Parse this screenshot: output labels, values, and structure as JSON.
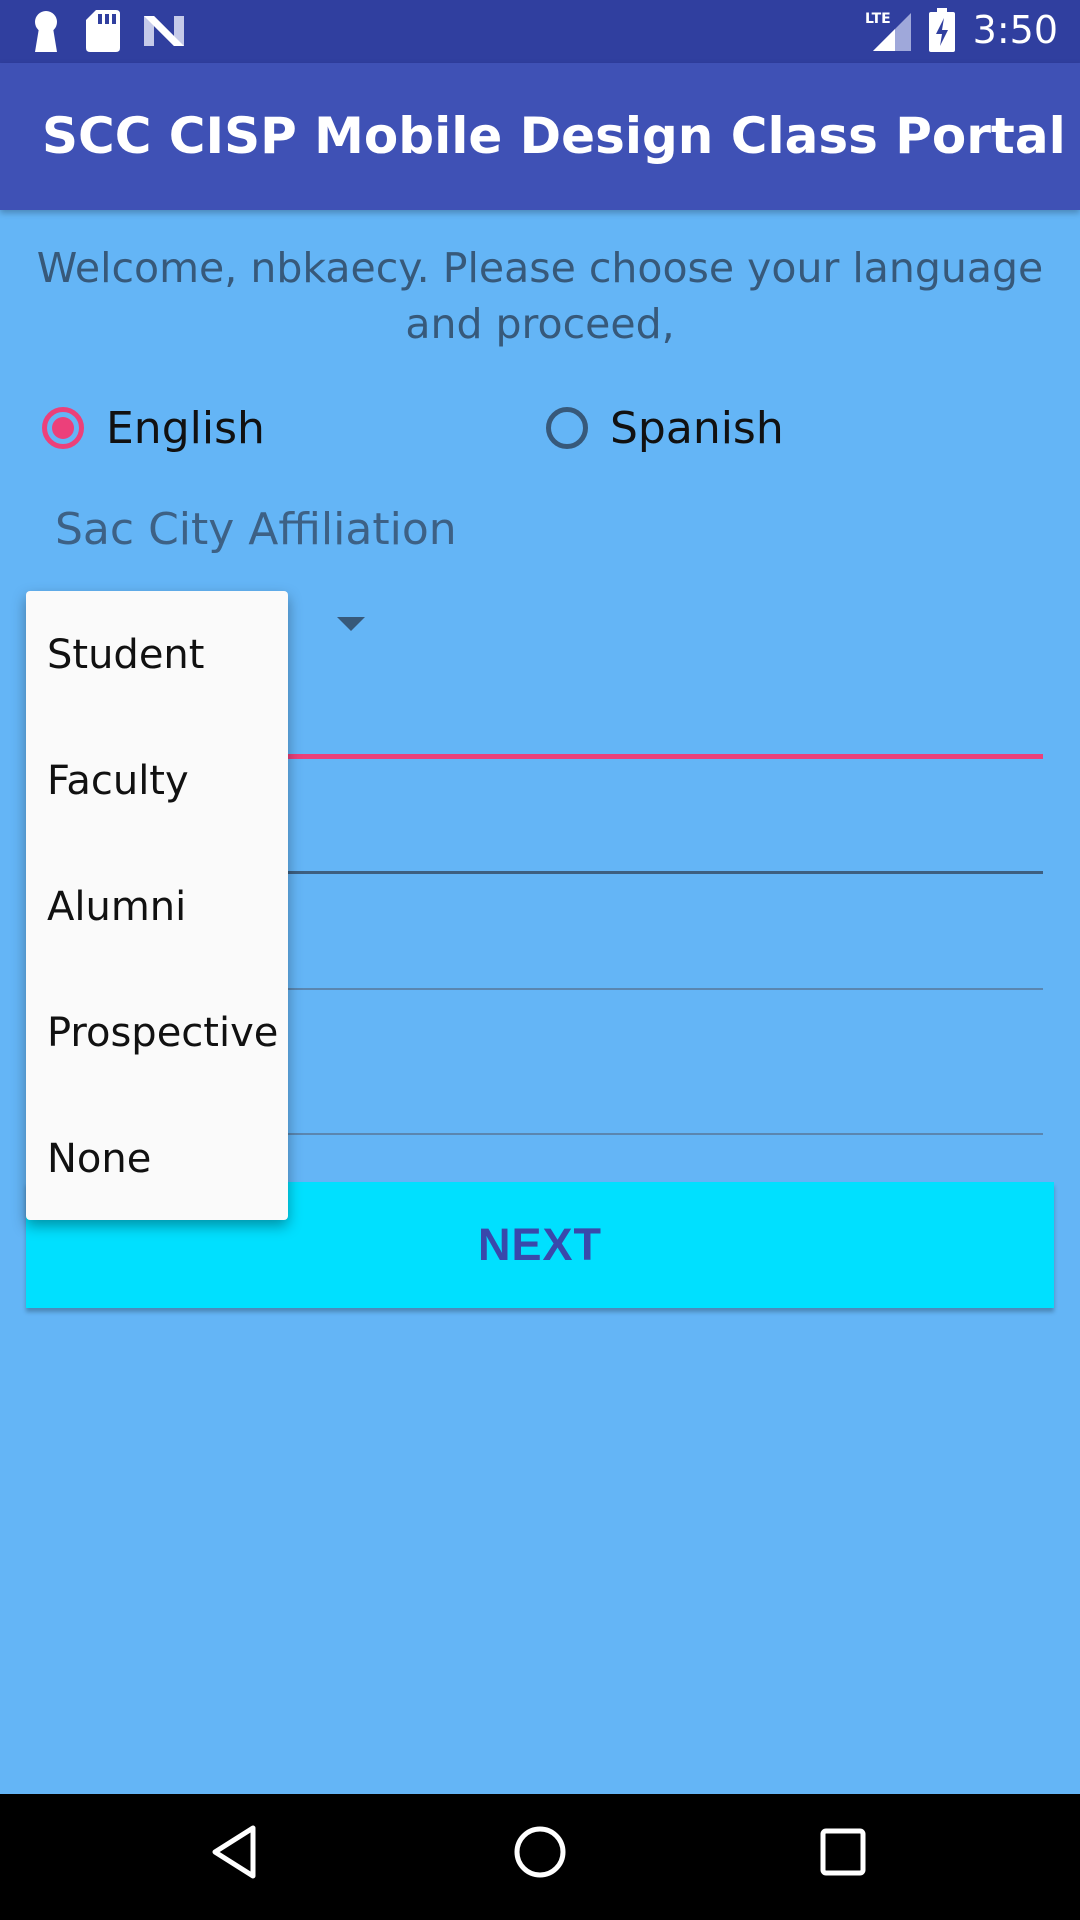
{
  "status_bar": {
    "time": "3:50",
    "icons": [
      "keyhole-icon",
      "sd-card-icon",
      "n-logo-icon",
      "lte-signal-icon",
      "battery-charging-icon"
    ]
  },
  "app_bar": {
    "title": "SCC CISP Mobile Design Class Portal",
    "background_color": "#3f51b5"
  },
  "welcome_text": "Welcome, nbkaecy. Please choose your language and proceed,",
  "language": {
    "options": [
      {
        "label": "English",
        "selected": true
      },
      {
        "label": "Spanish",
        "selected": false
      }
    ],
    "accent_color": "#ec407a"
  },
  "affiliation": {
    "label": "Sac City Affiliation",
    "options": [
      "Student",
      "Faculty",
      "Alumni",
      "Prospective",
      "None"
    ]
  },
  "next_button": {
    "label": "NEXT",
    "color": "#00e0ff"
  },
  "nav_bar": {
    "icons": [
      "back-icon",
      "home-icon",
      "recents-icon"
    ]
  }
}
